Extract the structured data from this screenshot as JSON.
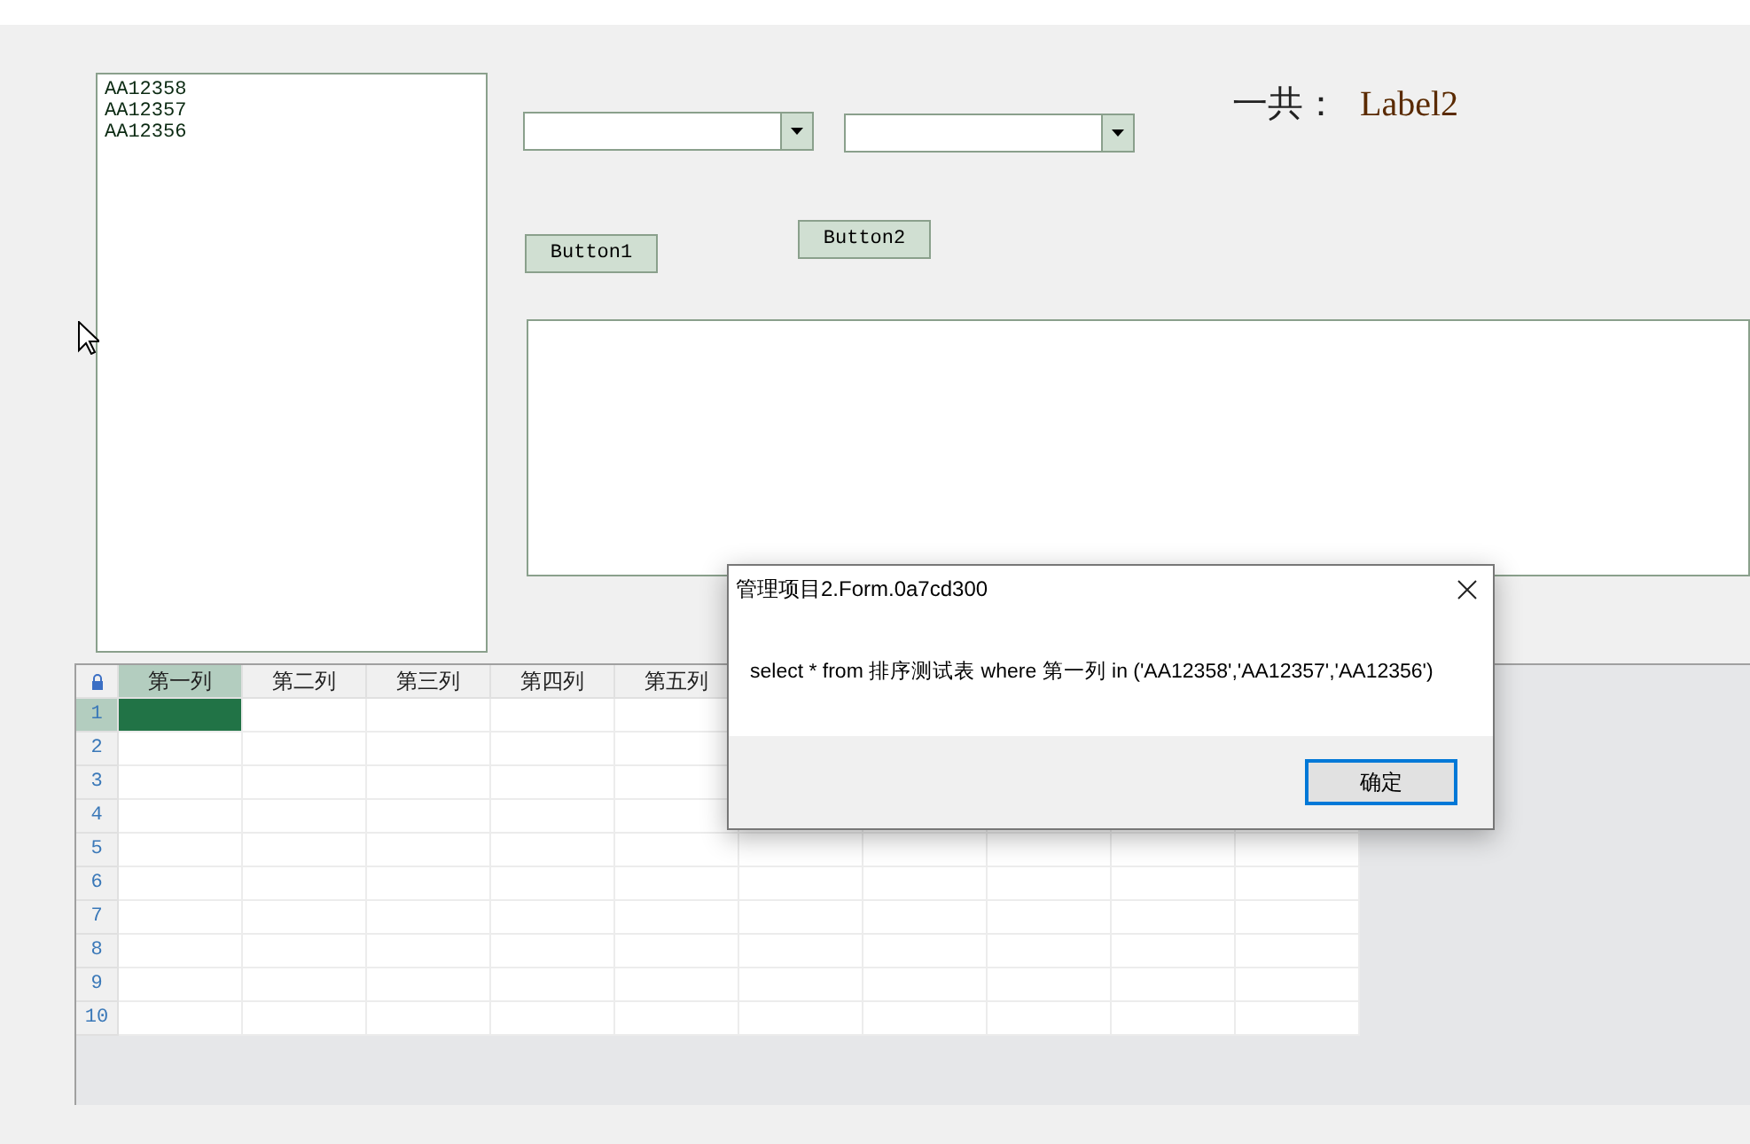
{
  "listbox": {
    "items": [
      "AA12358",
      "AA12357",
      "AA12356"
    ]
  },
  "count_label": {
    "caption": "一共：",
    "value": "Label2"
  },
  "buttons": [
    "Button1",
    "Button2"
  ],
  "grid": {
    "columns": [
      {
        "label": "第一列",
        "selected": true
      },
      {
        "label": "第二列",
        "selected": false
      },
      {
        "label": "第三列",
        "selected": false
      },
      {
        "label": "第四列",
        "selected": false
      },
      {
        "label": "第五列",
        "selected": false
      }
    ],
    "rows": [
      {
        "label": "1",
        "selected": true
      },
      {
        "label": "2",
        "selected": false
      },
      {
        "label": "3",
        "selected": false
      },
      {
        "label": "4",
        "selected": false
      },
      {
        "label": "5",
        "selected": false
      },
      {
        "label": "6",
        "selected": false
      },
      {
        "label": "7",
        "selected": false
      },
      {
        "label": "8",
        "selected": false
      },
      {
        "label": "9",
        "selected": false
      },
      {
        "label": "10",
        "selected": false
      }
    ]
  },
  "dialog": {
    "title": "管理项目2.Form.0a7cd300",
    "message": "select * from 排序测试表 where 第一列 in ('AA12358','AA12357','AA12356')",
    "button": "确定"
  }
}
